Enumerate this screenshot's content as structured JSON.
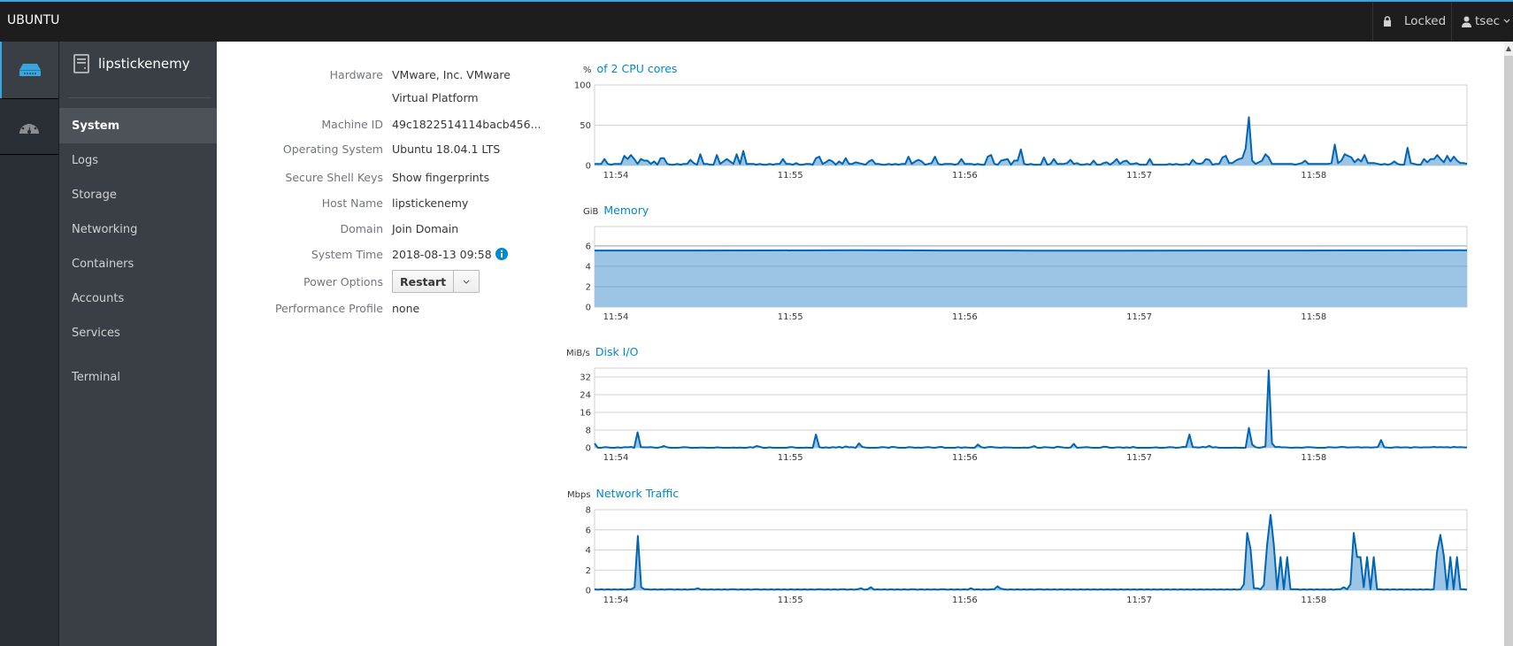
{
  "topbar": {
    "brand": "UBUNTU",
    "locked_label": "Locked",
    "user_name": "tsec",
    "lock_icon": "lock-icon",
    "user_icon": "user-icon"
  },
  "rail": {
    "items": [
      {
        "icon": "server-icon",
        "active": true
      },
      {
        "icon": "dashboard-icon",
        "active": false
      }
    ]
  },
  "sidebar": {
    "host_name": "lipstickenemy",
    "items": [
      {
        "label": "System",
        "active": true
      },
      {
        "label": "Logs"
      },
      {
        "label": "Storage"
      },
      {
        "label": "Networking"
      },
      {
        "label": "Containers"
      },
      {
        "label": "Accounts"
      },
      {
        "label": "Services"
      },
      {
        "label": "Terminal"
      }
    ]
  },
  "info": {
    "hardware_label": "Hardware",
    "hardware_value_1": "VMware, Inc. VMware",
    "hardware_value_2": "Virtual Platform",
    "machine_id_label": "Machine ID",
    "machine_id_value": "49c1822514114bacb456...",
    "os_label": "Operating System",
    "os_value": "Ubuntu 18.04.1 LTS",
    "ssh_label": "Secure Shell Keys",
    "ssh_value": "Show fingerprints",
    "host_label": "Host Name",
    "host_value": "lipstickenemy",
    "domain_label": "Domain",
    "domain_value": "Join Domain",
    "time_label": "System Time",
    "time_value": "2018-08-13 09:58",
    "power_label": "Power Options",
    "power_button": "Restart",
    "perf_label": "Performance Profile",
    "perf_value": "none"
  },
  "chart_data": [
    {
      "type": "area",
      "title": "of 2 CPU cores",
      "ylabel": "%",
      "ylim": [
        0,
        100
      ],
      "yticks": [
        0,
        50,
        100
      ],
      "x_ticks": [
        "11:54",
        "11:55",
        "11:56",
        "11:57",
        "11:58"
      ],
      "xlim_seconds": [
        0,
        300
      ],
      "x_tick_seconds": [
        2,
        62,
        122,
        182,
        242
      ],
      "grid": true,
      "sample_interval_s": 2,
      "values": [
        2,
        2,
        2,
        8,
        2,
        1,
        2,
        2,
        2,
        12,
        8,
        13,
        8,
        2,
        8,
        6,
        6,
        2,
        5,
        1,
        9,
        9,
        2,
        1,
        1,
        2,
        1,
        2,
        2,
        7,
        3,
        1,
        14,
        2,
        2,
        1,
        1,
        13,
        2,
        5,
        8,
        5,
        2,
        14,
        2,
        18,
        2,
        2,
        2,
        1,
        2,
        1,
        1,
        2,
        1,
        2,
        2,
        8,
        2,
        2,
        1,
        3,
        1,
        1,
        2,
        2,
        1,
        9,
        11,
        2,
        4,
        7,
        5,
        1,
        5,
        2,
        9,
        2,
        2,
        4,
        3,
        2,
        1,
        5,
        7,
        2,
        2,
        1,
        1,
        2,
        1,
        2,
        1,
        2,
        2,
        11,
        2,
        5,
        7,
        5,
        1,
        2,
        3,
        11,
        2,
        1,
        2,
        2,
        2,
        1,
        2,
        8,
        2,
        2,
        2,
        1,
        2,
        1,
        1,
        11,
        13,
        2,
        1,
        6,
        7,
        8,
        1,
        6,
        6,
        20,
        2,
        1,
        2,
        1,
        1,
        1,
        10,
        1,
        2,
        8,
        2,
        2,
        2,
        3,
        7,
        2,
        3,
        1,
        1,
        2,
        1,
        6,
        1,
        1,
        3,
        4,
        1,
        4,
        8,
        2,
        5,
        6,
        2,
        2,
        3,
        1,
        1,
        1,
        8,
        1,
        1,
        1,
        1,
        1,
        2,
        1,
        2,
        1,
        1,
        2,
        1,
        7,
        3,
        2,
        3,
        8,
        7,
        1,
        2,
        2,
        10,
        12,
        3,
        3,
        6,
        8,
        9,
        21,
        60,
        6,
        2,
        4,
        6,
        14,
        10,
        2,
        2,
        2,
        2,
        2,
        2,
        2,
        1,
        2,
        3,
        6,
        2,
        2,
        2,
        2,
        2,
        2,
        2,
        3,
        26,
        3,
        6,
        14,
        12,
        10,
        4,
        8,
        5,
        13,
        3,
        3,
        3,
        2,
        1,
        2,
        1,
        2,
        5,
        2,
        1,
        1,
        22,
        3,
        2,
        1,
        1,
        8,
        4,
        8,
        8,
        13,
        8,
        4,
        12,
        5,
        11,
        6,
        3,
        3,
        2
      ]
    },
    {
      "type": "area",
      "title": "Memory",
      "ylabel": "GiB",
      "ylim": [
        0,
        7.9
      ],
      "yticks": [
        0,
        2,
        4,
        6
      ],
      "x_ticks": [
        "11:54",
        "11:55",
        "11:56",
        "11:57",
        "11:58"
      ],
      "xlim_seconds": [
        0,
        300
      ],
      "x_tick_seconds": [
        2,
        62,
        122,
        182,
        242
      ],
      "grid": true,
      "values_note": "approximately constant",
      "values": [
        5.55,
        5.55,
        5.56,
        5.58,
        5.55,
        5.54,
        5.54,
        5.55,
        5.55,
        5.56,
        5.57
      ]
    },
    {
      "type": "area",
      "title": "Disk I/O",
      "ylabel": "MiB/s",
      "ylim": [
        0,
        36
      ],
      "yticks": [
        0,
        8,
        16,
        24,
        32
      ],
      "x_ticks": [
        "11:54",
        "11:55",
        "11:56",
        "11:57",
        "11:58"
      ],
      "xlim_seconds": [
        0,
        300
      ],
      "x_tick_seconds": [
        2,
        62,
        122,
        182,
        242
      ],
      "grid": true,
      "sample_interval_s": 2,
      "values": [
        2,
        0,
        0,
        0.3,
        0.2,
        0,
        0,
        0.2,
        0,
        0.3,
        0.2,
        0.4,
        0,
        7,
        0.3,
        0.2,
        0.2,
        0.3,
        0.1,
        0,
        0.3,
        0.8,
        0.2,
        0,
        0,
        0,
        0.1,
        0.3,
        0.2,
        0,
        0,
        0,
        0.1,
        0.1,
        0,
        0,
        0,
        0.2,
        0.1,
        0,
        0,
        0,
        0.1,
        0,
        0.1,
        0,
        0,
        0.3,
        0.1,
        0.8,
        0.5,
        0,
        0,
        0.2,
        0,
        0,
        0,
        0,
        0,
        0.3,
        0.3,
        0,
        0,
        0,
        0.1,
        0,
        0,
        6,
        0.3,
        0,
        0.2,
        0,
        0.3,
        0.1,
        0.4,
        0,
        0.6,
        0.2,
        0.3,
        0,
        2,
        0.4,
        0.1,
        0,
        0,
        0,
        0.1,
        0.3,
        0.2,
        0,
        0.4,
        0.3,
        0,
        0,
        0,
        0.3,
        0.2,
        0,
        0.1,
        0,
        0.2,
        0.3,
        0.1,
        0,
        0.3,
        0.4,
        0,
        0,
        0,
        0,
        0.3,
        0,
        0.2,
        0.1,
        0,
        0,
        1.5,
        0.3,
        0,
        0.3,
        0.4,
        0.2,
        0.1,
        0,
        0.2,
        0.1,
        0.1,
        0,
        0,
        0,
        0.1,
        0,
        0.2,
        0.8,
        0,
        0,
        0.3,
        0.2,
        0.1,
        0,
        0.5,
        0.3,
        0.1,
        0,
        0.1,
        1.8,
        0,
        0.1,
        0.2,
        0.3,
        0.1,
        0,
        0,
        0,
        0.5,
        0.4,
        0,
        0,
        0.2,
        0.2,
        0,
        0.2,
        0,
        0.4,
        0,
        0,
        0,
        0,
        0,
        0.1,
        0.2,
        0,
        0,
        0.1,
        0.3,
        0.2,
        0,
        0.1,
        0.4,
        0.3,
        6,
        0.3,
        0.2,
        0.1,
        0.4,
        0.2,
        0.9,
        0.1,
        0.3,
        0,
        0,
        0,
        0,
        0,
        0.1,
        0,
        0,
        0,
        9,
        1.5,
        0.3,
        0,
        0.2,
        0.6,
        35,
        2,
        0.3,
        0.4,
        0.2,
        0.2,
        0.1,
        0,
        0.1,
        0.1,
        0,
        0.2,
        0.3,
        0.2,
        0.1,
        0,
        0,
        0,
        0.3,
        0.2,
        0.1,
        0.2,
        0.4,
        0.3,
        0.1,
        0.2,
        0.2,
        0.3,
        0.1,
        0.2,
        0.2,
        0.1,
        0.2,
        0.3,
        3.5,
        0.2,
        0.1,
        0,
        0.2,
        0.3,
        0.1,
        0.2,
        0.2,
        0,
        0.3,
        0.2,
        0.1,
        0.2,
        0.2,
        0.2,
        0.4,
        0.2,
        0.3,
        0.2,
        0.3,
        0.1,
        0.4,
        0.2,
        0.3,
        0.2,
        0.1
      ]
    },
    {
      "type": "area",
      "title": "Network Traffic",
      "ylabel": "Mbps",
      "ylim": [
        0,
        8
      ],
      "yticks": [
        0,
        2,
        4,
        6,
        8
      ],
      "x_ticks": [
        "11:54",
        "11:55",
        "11:56",
        "11:57",
        "11:58"
      ],
      "xlim_seconds": [
        0,
        300
      ],
      "x_tick_seconds": [
        2,
        62,
        122,
        182,
        242
      ],
      "grid": true,
      "sample_interval_s": 2,
      "values": [
        0.1,
        0.05,
        0.1,
        0.05,
        0.1,
        0.05,
        0.1,
        0.05,
        0.1,
        0.05,
        0.1,
        0.1,
        0.3,
        5.4,
        0.3,
        0.1,
        0.1,
        0.05,
        0.1,
        0.05,
        0.1,
        0.05,
        0.1,
        0.1,
        0.05,
        0.1,
        0.05,
        0.1,
        0.05,
        0.1,
        0.1,
        0.2,
        0.05,
        0.1,
        0.05,
        0.1,
        0.05,
        0.1,
        0.05,
        0.1,
        0.05,
        0.1,
        0.1,
        0.05,
        0.1,
        0.05,
        0.1,
        0.05,
        0.1,
        0.1,
        0.05,
        0.1,
        0.05,
        0.1,
        0.05,
        0.1,
        0.05,
        0.1,
        0.05,
        0.1,
        0.05,
        0.1,
        0.05,
        0.1,
        0.05,
        0.1,
        0.05,
        0.1,
        0.1,
        0.05,
        0.1,
        0.05,
        0.1,
        0.05,
        0.1,
        0.1,
        0.05,
        0.1,
        0.05,
        0.1,
        0.2,
        0.05,
        0.1,
        0.3,
        0.05,
        0.1,
        0.05,
        0.1,
        0.05,
        0.1,
        0.05,
        0.1,
        0.05,
        0.1,
        0.05,
        0.1,
        0.1,
        0.05,
        0.1,
        0.05,
        0.1,
        0.05,
        0.1,
        0.05,
        0.1,
        0.1,
        0.05,
        0.1,
        0.05,
        0.1,
        0.05,
        0.1,
        0.05,
        0.2,
        0.05,
        0.1,
        0.05,
        0.1,
        0.05,
        0.1,
        0.1,
        0.4,
        0.15,
        0.1,
        0.05,
        0.1,
        0.05,
        0.1,
        0.05,
        0.1,
        0.05,
        0.1,
        0.05,
        0.1,
        0.1,
        0.05,
        0.1,
        0.05,
        0.1,
        0.05,
        0.1,
        0.05,
        0.1,
        0.05,
        0.1,
        0.05,
        0.1,
        0.05,
        0.1,
        0.05,
        0.1,
        0.05,
        0.1,
        0.05,
        0.1,
        0.05,
        0.1,
        0.05,
        0.1,
        0.05,
        0.1,
        0.05,
        0.1,
        0.05,
        0.1,
        0.05,
        0.1,
        0.05,
        0.1,
        0.05,
        0.1,
        0.05,
        0.1,
        0.05,
        0.1,
        0.05,
        0.1,
        0.05,
        0.1,
        0.05,
        0.1,
        0.05,
        0.1,
        0.05,
        0.1,
        0.05,
        0.1,
        0.05,
        0.1,
        0.05,
        0.1,
        0.05,
        0.1,
        0.05,
        0.1,
        0.6,
        5.7,
        4.1,
        0.2,
        0.2,
        0.1,
        0.5,
        4.6,
        7.5,
        4.5,
        0.1,
        3.3,
        0.1,
        3.3,
        0.1,
        0.1,
        0.1,
        0.05,
        0.1,
        0.05,
        0.1,
        0.05,
        0.1,
        0.05,
        0.1,
        0.05,
        0.1,
        0.05,
        0.1,
        0.1,
        0.3,
        0.1,
        0.6,
        5.7,
        3.3,
        3.3,
        0.3,
        3.3,
        0.1,
        3.3,
        0.1,
        0.1,
        0.05,
        0.1,
        0.05,
        0.1,
        0.05,
        0.1,
        0.05,
        0.1,
        0.05,
        0.1,
        0.05,
        0.1,
        0.05,
        0.1,
        0.05,
        0.1,
        3.8,
        5.5,
        3.5,
        0.1,
        3.3,
        0.1,
        3.3,
        0.1,
        0.1,
        0.05
      ]
    }
  ],
  "colors": {
    "accent": "#0088ce",
    "topbar_border": "#39a5dc",
    "line": "#0066b3",
    "fill": "#9cc5e5"
  }
}
